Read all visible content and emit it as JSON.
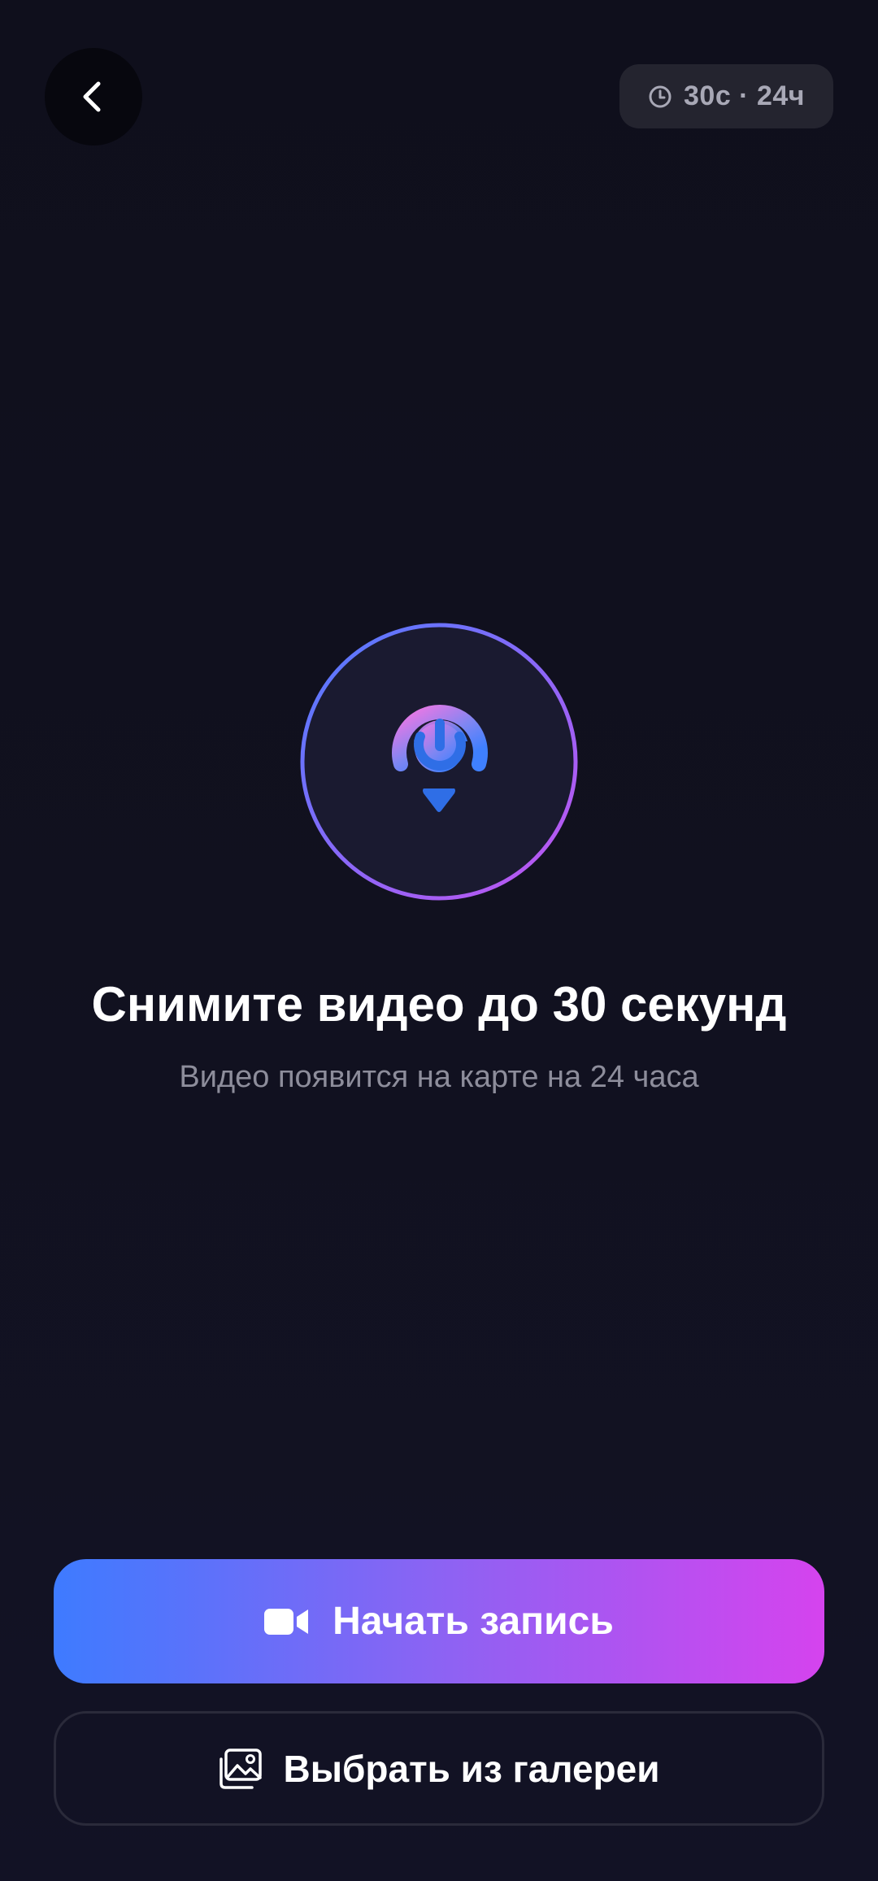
{
  "header": {
    "back_icon": "chevron-left-icon",
    "timer_icon": "clock-icon",
    "timer_text": "30с · 24ч"
  },
  "main": {
    "emblem_icon": "map-pin-video-icon",
    "title": "Снимите видео до 30 секунд",
    "subtitle": "Видео появится на карте на 24 часа"
  },
  "actions": {
    "record_icon": "video-camera-icon",
    "record_label": "Начать запись",
    "gallery_icon": "gallery-image-icon",
    "gallery_label": "Выбрать из галереи"
  },
  "colors": {
    "background": "#11111f",
    "accent_start": "#3e7bff",
    "accent_end": "#d543ee",
    "muted_text": "#8d8d9b"
  }
}
